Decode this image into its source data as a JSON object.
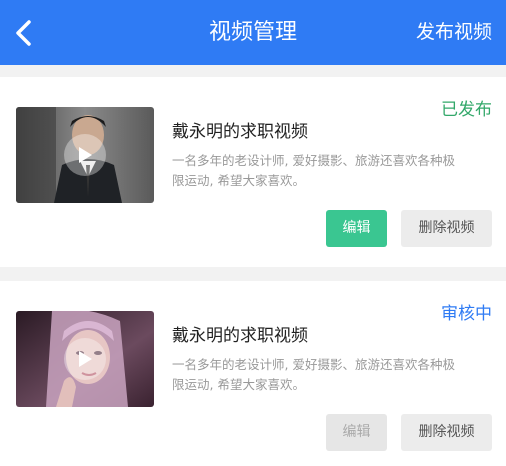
{
  "header": {
    "title": "视频管理",
    "publish_label": "发布视频"
  },
  "videos": [
    {
      "title": "戴永明的求职视频",
      "desc_line1": "一名多年的老设计师, 爱好摄影、旅游还喜欢各种极",
      "desc_line2": "限运动, 希望大家喜欢。",
      "status": "已发布",
      "edit_label": "编辑",
      "delete_label": "删除视频"
    },
    {
      "title": "戴永明的求职视频",
      "desc_line1": "一名多年的老设计师, 爱好摄影、旅游还喜欢各种极",
      "desc_line2": "限运动, 希望大家喜欢。",
      "status": "审核中",
      "edit_label": "编辑",
      "delete_label": "删除视频"
    }
  ],
  "colors": {
    "header_bg": "#2f7bf4",
    "published": "#33a86a",
    "reviewing": "#2f7bf4",
    "edit_active": "#3ac691"
  },
  "icons": [
    "back-arrow-icon",
    "play-icon"
  ]
}
